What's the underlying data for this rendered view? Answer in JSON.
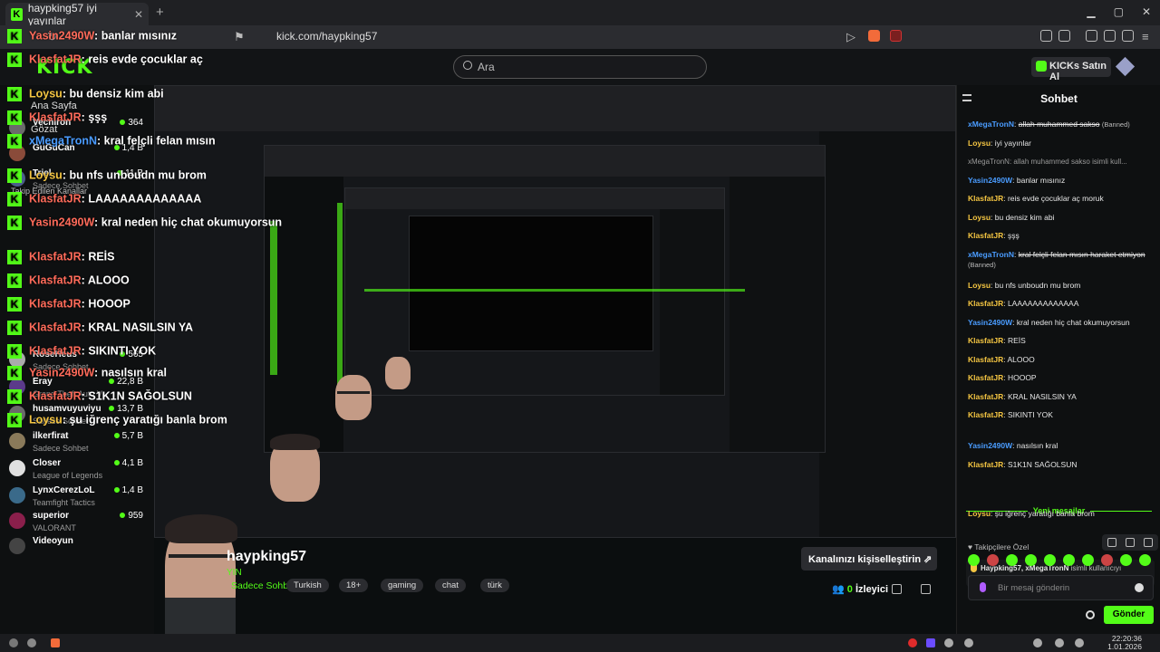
{
  "browser": {
    "tab_title": "haypking57 iyi yayınlar",
    "url": "kick.com/haypking57",
    "new_tab": "+",
    "close": "✕"
  },
  "header": {
    "search_placeholder": "Ara",
    "kicks_button": "KICKs Satın Al",
    "logo": "KICK"
  },
  "overlay_chat": [
    {
      "user": "Yasin2490W",
      "color": "u-red",
      "text": "banlar mısınız"
    },
    {
      "user": "KlasfatJR",
      "color": "u-red",
      "text": "reis evde çocuklar aç"
    },
    {
      "user": "Loysu",
      "color": "u-yellow",
      "text": "bu densiz kim abi"
    },
    {
      "user": "KlasfatJR",
      "color": "u-red",
      "text": "şşş"
    },
    {
      "user": "xMegaTronN",
      "color": "u-blue",
      "text": "kral felçli felan mısın"
    },
    {
      "user": "Loysu",
      "color": "u-yellow",
      "text": "bu nfs unboudn mu brom"
    },
    {
      "user": "KlasfatJR",
      "color": "u-red",
      "text": "LAAAAAAAAAAAAA"
    },
    {
      "user": "Yasin2490W",
      "color": "u-red",
      "text": "kral neden hiç chat okumuyorsun"
    },
    {
      "user": "KlasfatJR",
      "color": "u-red",
      "text": "REİS"
    },
    {
      "user": "KlasfatJR",
      "color": "u-red",
      "text": "ALOOO"
    },
    {
      "user": "KlasfatJR",
      "color": "u-red",
      "text": "HOOOP"
    },
    {
      "user": "KlasfatJR",
      "color": "u-red",
      "text": "KRAL NASILSIN YA"
    },
    {
      "user": "KlasfatJR",
      "color": "u-red",
      "text": "SIKINTI YOK"
    },
    {
      "user": "Yasin2490W",
      "color": "u-red",
      "text": "nasılsın kral"
    },
    {
      "user": "KlasfatJR",
      "color": "u-red",
      "text": "S1K1N SAĞOLSUN"
    },
    {
      "user": "Loysu",
      "color": "u-yellow",
      "text": "şu iğrenç yaratığı banla brom"
    }
  ],
  "sidebar": {
    "home": "Ana Sayfa",
    "browse": "Gözat",
    "following_title": "Takip Edilen Kanallar",
    "channels": [
      {
        "name": "Vechiron",
        "category": "",
        "count": "364"
      },
      {
        "name": "GuGuCan",
        "category": "",
        "count": "1,4 B"
      },
      {
        "name": "Triel",
        "category": "Sadece Sohbet",
        "count": "11 B"
      },
      {
        "name": "RoseHeus",
        "category": "Sadece Sohbet",
        "count": "565"
      },
      {
        "name": "Eray",
        "category": "Grand Theft Auto V",
        "count": "22,8 B"
      },
      {
        "name": "husamvuyuviyu",
        "category": "Sadece Sohbet",
        "count": "13,7 B"
      },
      {
        "name": "ilkerfirat",
        "category": "Sadece Sohbet",
        "count": "5,7 B"
      },
      {
        "name": "Closer",
        "category": "League of Legends",
        "count": "4,1 B"
      },
      {
        "name": "LynxCerezLoL",
        "category": "Teamfight Tactics",
        "count": "1,4 B"
      },
      {
        "name": "superior",
        "category": "VALORANT",
        "count": "959"
      },
      {
        "name": "Videoyun",
        "category": "",
        "count": ""
      }
    ]
  },
  "stream": {
    "streamer": "haypking57",
    "status": "YIN",
    "category": "Sadece Sohbet",
    "tags": [
      "Turkish",
      "18+",
      "gaming",
      "chat",
      "türk"
    ],
    "customize": "Kanalınızı kişiselleştirin",
    "viewers_count": "0",
    "viewers_label": "İzleyici"
  },
  "chat": {
    "title": "Sohbet",
    "messages": [
      {
        "user": "xMegaTronN",
        "color": "u-blue",
        "text": "allah muhammed sakso",
        "note": "(Banned)",
        "strike": true
      },
      {
        "user": "Loysu",
        "color": "u-yellow",
        "text": "iyi yayınlar"
      },
      {
        "user": "",
        "color": "",
        "text": "xMegaTronN: allah muhammed sakso isimli kull...",
        "sys": true
      },
      {
        "user": "Yasin2490W",
        "color": "u-blue",
        "text": "banlar mısınız"
      },
      {
        "user": "KlasfatJR",
        "color": "u-yellow",
        "text": "reis evde çocuklar aç moruk"
      },
      {
        "user": "Loysu",
        "color": "u-yellow",
        "text": "bu densiz kim abi"
      },
      {
        "user": "KlasfatJR",
        "color": "u-yellow",
        "text": "şşş"
      },
      {
        "user": "xMegaTronN",
        "color": "u-blue",
        "text": "kral felçli felan mısın haraket etmiyon",
        "note": "(Banned)",
        "strike": true
      },
      {
        "user": "Loysu",
        "color": "u-yellow",
        "text": "bu nfs unboudn mu brom"
      },
      {
        "user": "KlasfatJR",
        "color": "u-yellow",
        "text": "LAAAAAAAAAAAAA"
      },
      {
        "user": "Yasin2490W",
        "color": "u-blue",
        "text": "kral neden hiç chat okumuyorsun"
      },
      {
        "user": "KlasfatJR",
        "color": "u-yellow",
        "text": "REİS"
      },
      {
        "user": "KlasfatJR",
        "color": "u-yellow",
        "text": "ALOOO"
      },
      {
        "user": "KlasfatJR",
        "color": "u-yellow",
        "text": "HOOOP"
      },
      {
        "user": "KlasfatJR",
        "color": "u-yellow",
        "text": "KRAL NASILSIN YA"
      },
      {
        "user": "KlasfatJR",
        "color": "u-yellow",
        "text": "SIKINTI YOK"
      }
    ],
    "new_messages": "Yeni mesajlar",
    "after_messages": [
      {
        "user": "Yasin2490W",
        "color": "u-blue",
        "text": "nasılsın kral"
      },
      {
        "user": "KlasfatJR",
        "color": "u-yellow",
        "text": "S1K1N SAĞOLSUN"
      }
    ],
    "ban_notice_users": "Haypking57, xMegaTronN",
    "ban_notice_text": "isimli kullanıcıyı yasakladı",
    "last_message": {
      "user": "Loysu",
      "color": "u-yellow",
      "text": "şu iğrenç yaratığı banla brom"
    },
    "followers_only": "Takipçilere Özel",
    "input_placeholder": "Bir mesaj gönderin",
    "send": "Gönder"
  },
  "taskbar": {
    "time": "22:20:36",
    "date": "1.01.2026"
  },
  "colors": {
    "accent": "#53fc18",
    "bg": "#0b0e0f",
    "panel": "#0e1011"
  }
}
